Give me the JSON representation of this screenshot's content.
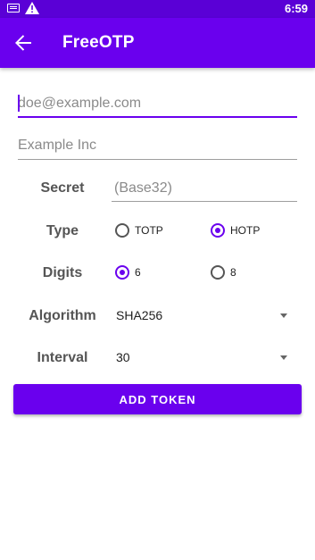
{
  "status_bar": {
    "time": "6:59",
    "icons": [
      "keyboard-icon",
      "warning-icon"
    ],
    "color": "#5a00d6"
  },
  "app_bar": {
    "title": "FreeOTP",
    "back_icon": "arrow-back-icon",
    "color": "#6a00ee"
  },
  "form": {
    "issuer_account": {
      "value": "",
      "placeholder": "doe@example.com"
    },
    "issuer_name": {
      "value": "",
      "placeholder": "Example Inc"
    },
    "secret": {
      "label": "Secret",
      "value": "",
      "placeholder": "(Base32)"
    },
    "type": {
      "label": "Type",
      "options": [
        {
          "label": "TOTP",
          "selected": false
        },
        {
          "label": "HOTP",
          "selected": true
        }
      ]
    },
    "digits": {
      "label": "Digits",
      "options": [
        {
          "label": "6",
          "selected": true
        },
        {
          "label": "8",
          "selected": false
        }
      ]
    },
    "algorithm": {
      "label": "Algorithm",
      "value": "SHA256"
    },
    "interval": {
      "label": "Interval",
      "value": "30"
    }
  },
  "add_button": {
    "label": "ADD TOKEN",
    "color": "#6a00ee"
  }
}
